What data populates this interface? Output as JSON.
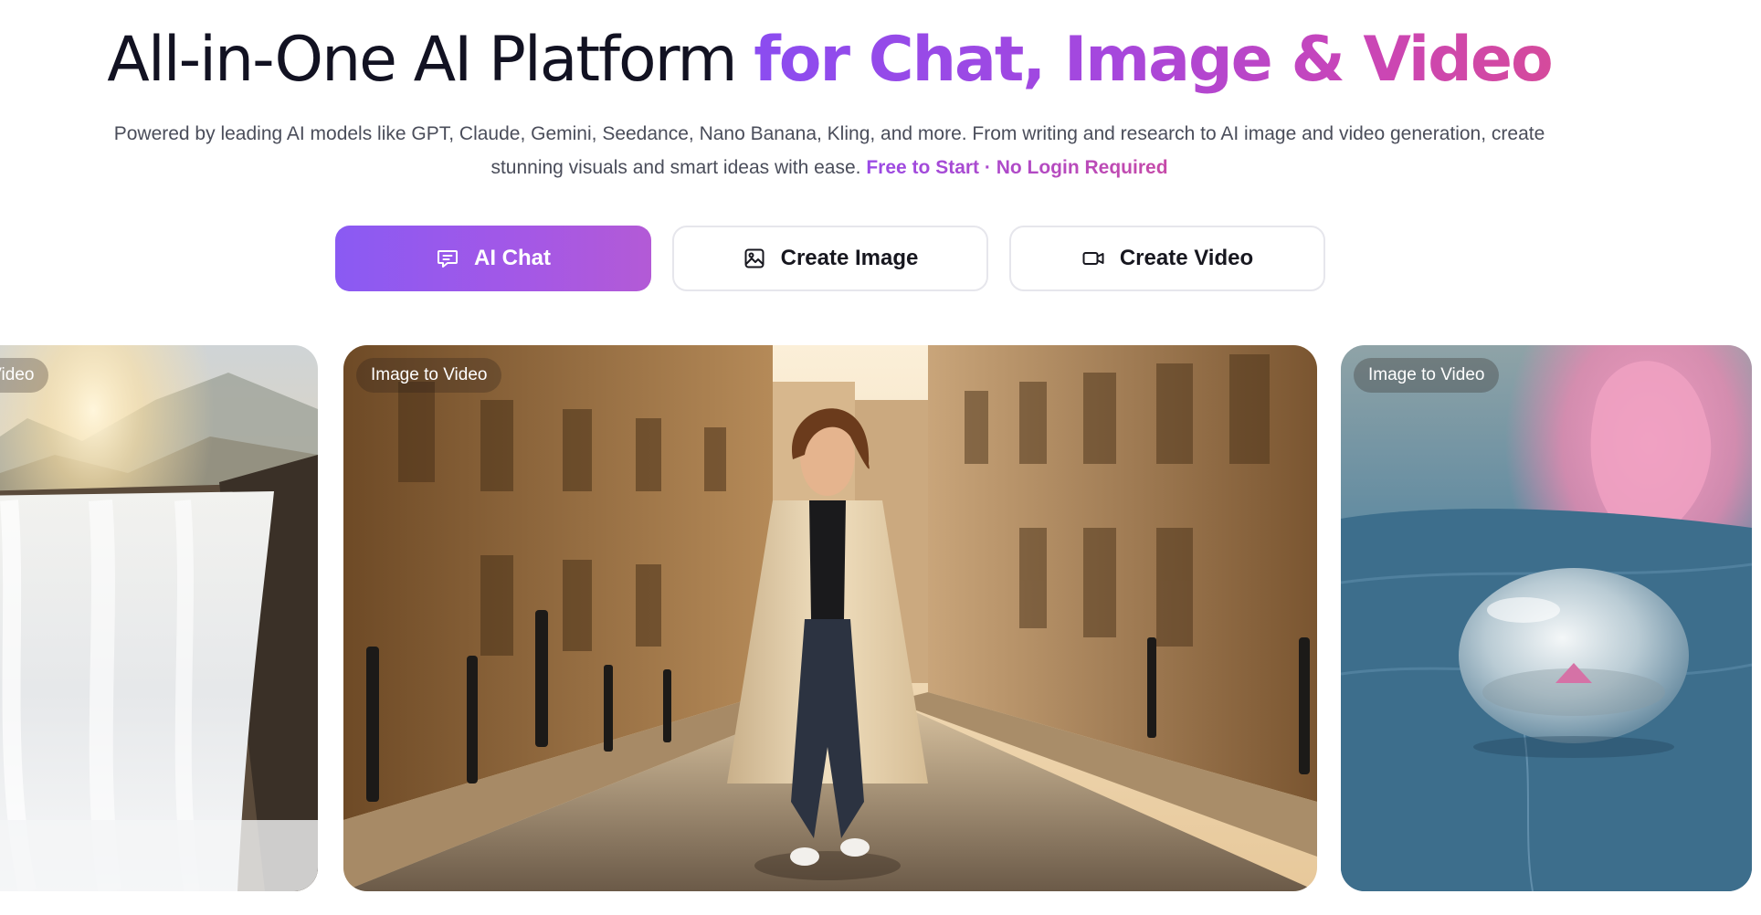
{
  "hero": {
    "title_plain": "All-in-One AI Platform ",
    "title_highlight": "for Chat, Image & Video",
    "subtitle": "Powered by leading AI models like GPT, Claude, Gemini, Seedance, Nano Banana, Kling, and more. From writing and research to AI image and video generation, create stunning visuals and smart ideas with ease. ",
    "subtitle_highlight": "Free to Start · No Login Required"
  },
  "modes": [
    {
      "label": "AI Chat",
      "icon": "chat-icon",
      "active": true
    },
    {
      "label": "Create Image",
      "icon": "image-icon",
      "active": false
    },
    {
      "label": "Create Video",
      "icon": "video-camera-icon",
      "active": false
    }
  ],
  "gallery": [
    {
      "badge": "Image to Video",
      "subject": "waterfall at sunset"
    },
    {
      "badge": "Image to Video",
      "subject": "woman walking on cobblestone street"
    },
    {
      "badge": "Image to Video",
      "subject": "water droplet with lotus flower"
    }
  ],
  "colors": {
    "title_text": "#121222",
    "accent_start": "#8b4cf0",
    "accent_end": "#d54a9c",
    "subtitle_text": "#4a4d5a",
    "button_border": "#e6e6ec"
  }
}
